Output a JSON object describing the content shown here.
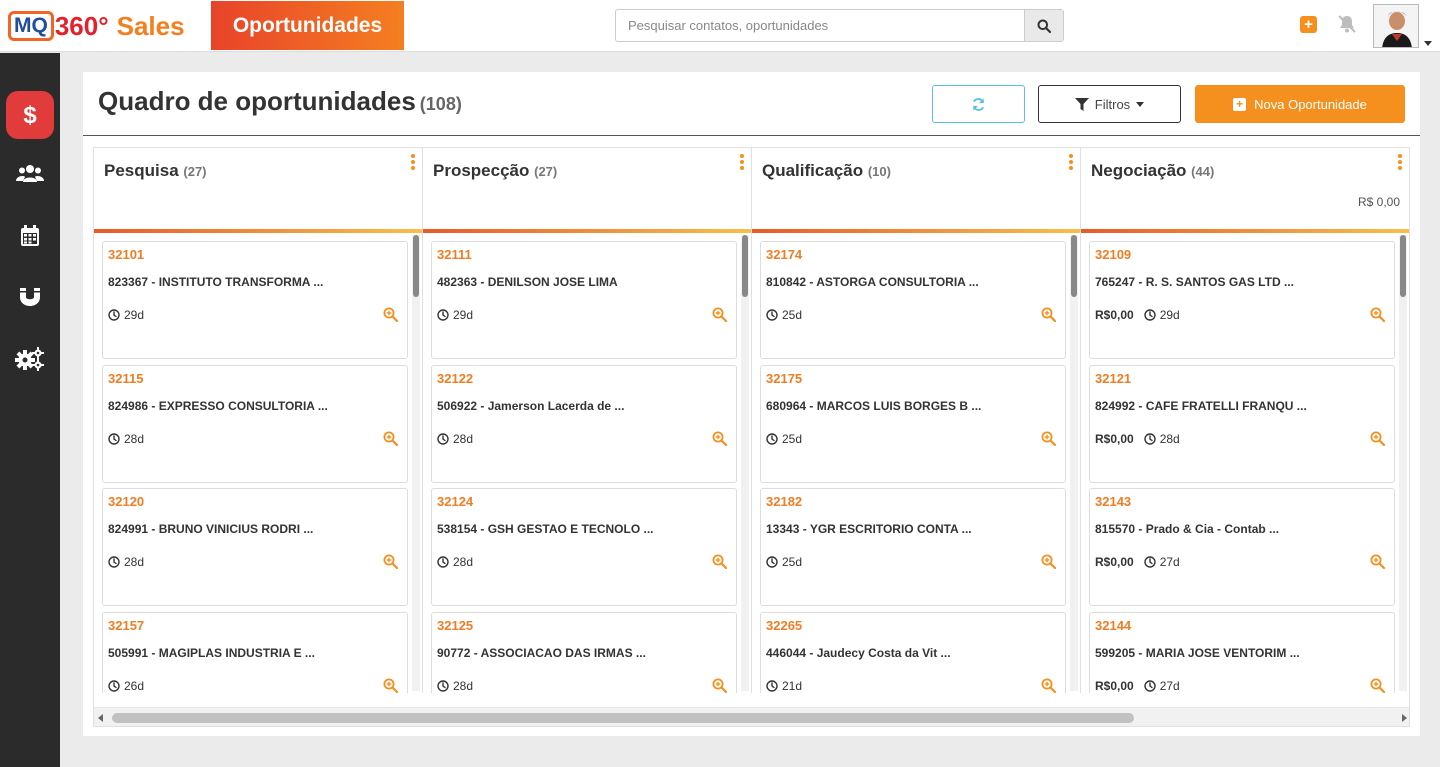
{
  "brand": {
    "logo_mq": "MQ",
    "logo_360": "360°",
    "logo_sales": "Sales",
    "accent": "#f5901e",
    "brand_red": "#e3212a"
  },
  "header": {
    "module_title": "Oportunidades",
    "search_placeholder": "Pesquisar contatos, oportunidades",
    "icons": [
      "search-icon",
      "plus-square-icon",
      "bell-slash-icon",
      "avatar",
      "caret-down-icon"
    ]
  },
  "sidebar": {
    "items": [
      {
        "icon": "dollar-icon",
        "active": true
      },
      {
        "icon": "users-icon",
        "active": false
      },
      {
        "icon": "calendar-icon",
        "active": false
      },
      {
        "icon": "magnet-icon",
        "active": false
      },
      {
        "icon": "gears-icon",
        "active": false
      }
    ]
  },
  "board": {
    "title": "Quadro de oportunidades",
    "count": "(108)",
    "filter_label": "Filtros",
    "new_label": "Nova Oportunidade",
    "columns": [
      {
        "title": "Pesquisa",
        "count": "(27)",
        "total": "",
        "cards": [
          {
            "id": "32101",
            "name": "823367 - INSTITUTO TRANSFORMA ...",
            "value": "",
            "age": "29d"
          },
          {
            "id": "32115",
            "name": "824986 - EXPRESSO CONSULTORIA ...",
            "value": "",
            "age": "28d"
          },
          {
            "id": "32120",
            "name": "824991 - BRUNO VINICIUS RODRI ...",
            "value": "",
            "age": "28d"
          },
          {
            "id": "32157",
            "name": "505991 - MAGIPLAS INDUSTRIA E ...",
            "value": "",
            "age": "26d"
          }
        ]
      },
      {
        "title": "Prospecção",
        "count": "(27)",
        "total": "",
        "cards": [
          {
            "id": "32111",
            "name": "482363 - DENILSON JOSE LIMA",
            "value": "",
            "age": "29d"
          },
          {
            "id": "32122",
            "name": "506922 - Jamerson Lacerda de ...",
            "value": "",
            "age": "28d"
          },
          {
            "id": "32124",
            "name": "538154 - GSH GESTAO E TECNOLO ...",
            "value": "",
            "age": "28d"
          },
          {
            "id": "32125",
            "name": "90772 - ASSOCIACAO DAS IRMAS ...",
            "value": "",
            "age": "28d"
          }
        ]
      },
      {
        "title": "Qualificação",
        "count": "(10)",
        "total": "",
        "cards": [
          {
            "id": "32174",
            "name": "810842 - ASTORGA CONSULTORIA ...",
            "value": "",
            "age": "25d"
          },
          {
            "id": "32175",
            "name": "680964 - MARCOS LUIS BORGES B ...",
            "value": "",
            "age": "25d"
          },
          {
            "id": "32182",
            "name": "13343 - YGR ESCRITORIO CONTA ...",
            "value": "",
            "age": "25d"
          },
          {
            "id": "32265",
            "name": "446044 - Jaudecy Costa da Vit ...",
            "value": "",
            "age": "21d"
          }
        ]
      },
      {
        "title": "Negociação",
        "count": "(44)",
        "total": "R$ 0,00",
        "cards": [
          {
            "id": "32109",
            "name": "765247 - R. S. SANTOS GAS LTD ...",
            "value": "R$0,00",
            "age": "29d"
          },
          {
            "id": "32121",
            "name": "824992 - CAFE FRATELLI FRANQU ...",
            "value": "R$0,00",
            "age": "28d"
          },
          {
            "id": "32143",
            "name": "815570 - Prado & Cia - Contab ...",
            "value": "R$0,00",
            "age": "27d"
          },
          {
            "id": "32144",
            "name": "599205 - MARIA JOSE VENTORIM ...",
            "value": "R$0,00",
            "age": "27d"
          }
        ]
      }
    ]
  }
}
